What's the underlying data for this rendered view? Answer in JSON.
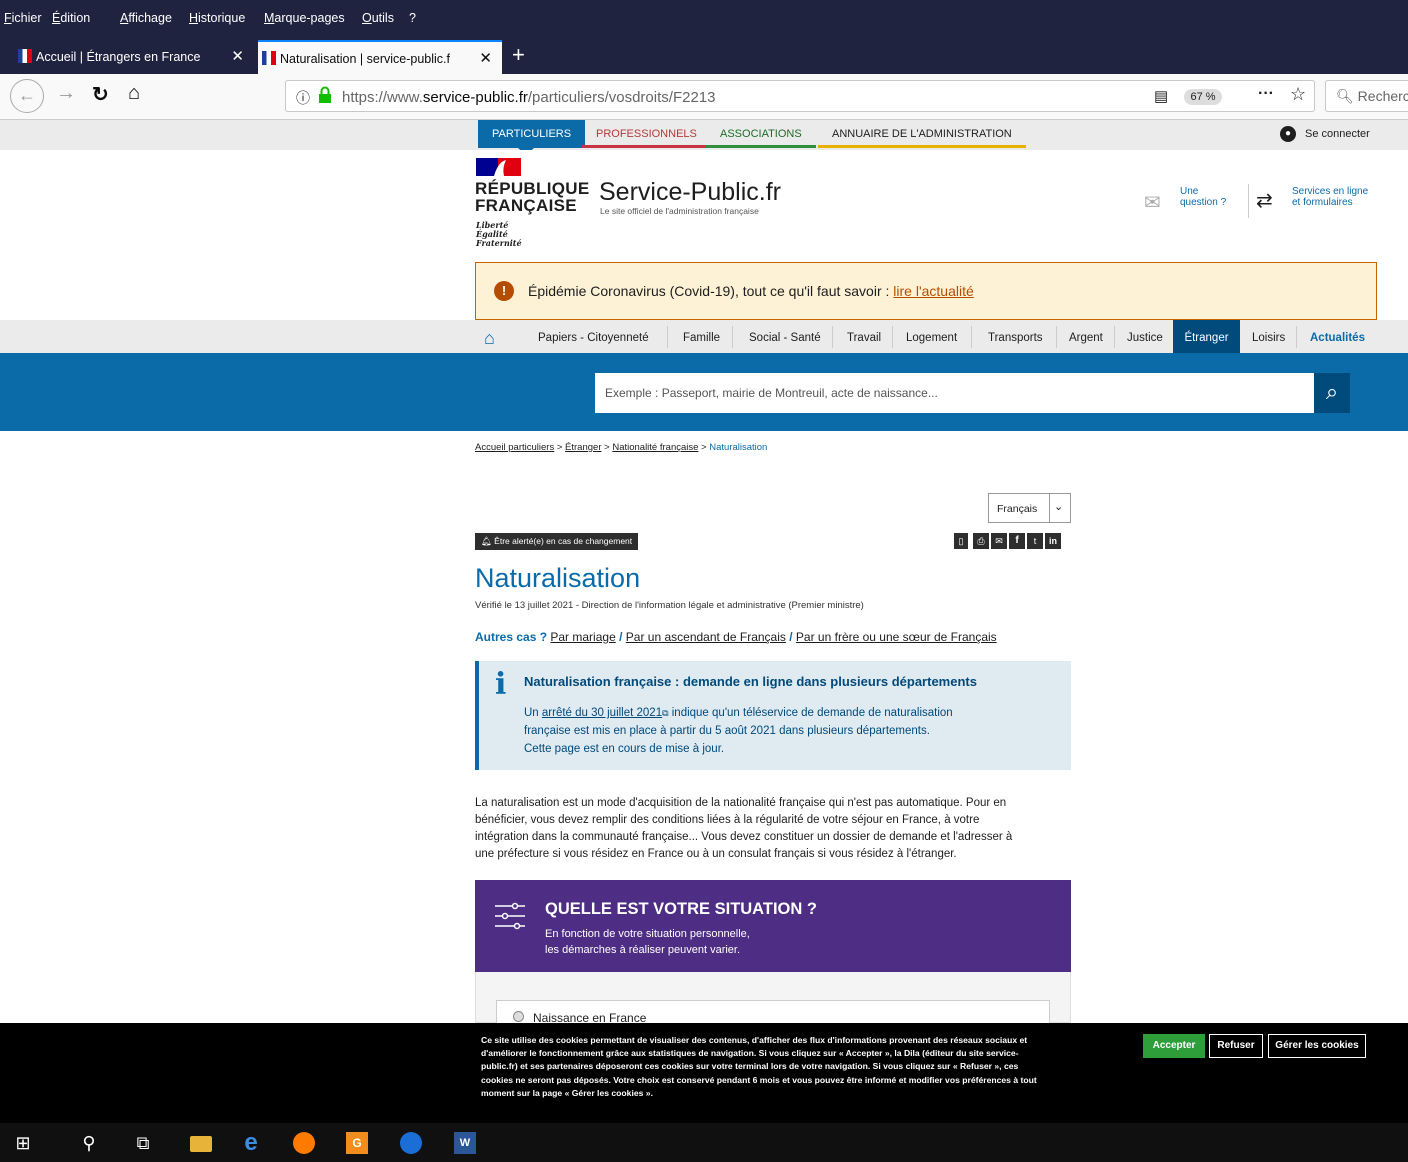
{
  "menubar": {
    "items": [
      "Fichier",
      "Édition",
      "Affichage",
      "Historique",
      "Marque-pages",
      "Outils",
      "?"
    ]
  },
  "tabs": [
    {
      "label": "Accueil | Étrangers en France"
    },
    {
      "label": "Naturalisation | service-public.f"
    }
  ],
  "navbar": {
    "url_prefix": "https://www.",
    "url_domain": "service-public.fr",
    "url_path": "/particuliers/vosdroits/F2213",
    "zoom": "67 %",
    "search_placeholder": "Recherc"
  },
  "topnav": {
    "items": [
      "PARTICULIERS",
      "PROFESSIONNELS",
      "ASSOCIATIONS",
      "ANNUAIRE DE L'ADMINISTRATION"
    ],
    "login": "Se connecter"
  },
  "header": {
    "rf_line1": "RÉPUBLIQUE",
    "rf_line2": "FRANÇAISE",
    "motto1": "Liberté",
    "motto2": "Égalité",
    "motto3": "Fraternité",
    "site_name": "Service-Public.fr",
    "site_tagline": "Le site officiel de l'administration française",
    "question_1": "Une",
    "question_2": "question ?",
    "services_1": "Services en ligne",
    "services_2": "et formulaires"
  },
  "covid": {
    "text": "Épidémie Coronavirus (Covid-19), tout ce qu'il faut savoir : ",
    "link": "lire l'actualité"
  },
  "catnav": {
    "items": [
      "Papiers - Citoyenneté",
      "Famille",
      "Social - Santé",
      "Travail",
      "Logement",
      "Transports",
      "Argent",
      "Justice",
      "Étranger",
      "Loisirs",
      "Actualités"
    ]
  },
  "search": {
    "placeholder": "Exemple : Passeport, mairie de Montreuil, acte de naissance..."
  },
  "breadcrumb": {
    "items": [
      "Accueil particuliers",
      "Étranger",
      "Nationalité française",
      "Naturalisation"
    ],
    "sep": ">"
  },
  "lang": {
    "selected": "Français"
  },
  "alert_btn": "Être alerté(e) en cas de changement",
  "page": {
    "title": "Naturalisation",
    "verified": "Vérifié le 13 juillet 2021 - Direction de l'information légale et administrative (Premier ministre)",
    "autres_label": "Autres cas ?",
    "autres_links": [
      "Par mariage",
      "Par un ascendant de Français",
      "Par un frère ou une sœur de Français"
    ],
    "info_title": "Naturalisation française : demande en ligne dans plusieurs départements",
    "info_pre": "Un ",
    "info_link": "arrêté du 30 juillet 2021",
    "info_text1": " indique qu'un téléservice de demande de naturalisation",
    "info_text2": "française est mis en place à partir du 5 août 2021 dans plusieurs départements.",
    "info_text3": "Cette page est en cours de mise à jour.",
    "intro1": "La naturalisation est un mode d'acquisition de la nationalité française qui n'est pas automatique. Pour en",
    "intro2": "bénéficier, vous devez remplir des conditions liées à la régularité de votre séjour en France, à votre",
    "intro3": "intégration dans la communauté française... Vous devez constituer un dossier de demande et l'adresser à",
    "intro4": "une préfecture si vous résidez en France ou à un consulat français si vous résidez à l'étranger.",
    "situation_title": "QUELLE EST VOTRE SITUATION ?",
    "situation_sub1": "En fonction de votre situation personnelle,",
    "situation_sub2": "les démarches à réaliser peuvent varier.",
    "radio1": "Naissance en France"
  },
  "cookie": {
    "l1": "Ce site utilise des cookies permettant de visualiser des contenus, d'afficher des flux d'informations provenant des réseaux sociaux et",
    "l2": "d'améliorer le fonctionnement grâce aux statistiques de navigation. Si vous cliquez sur « Accepter », la Dila (éditeur du site service-",
    "l3": "public.fr) et ses partenaires déposeront ces cookies sur votre terminal lors de votre navigation. Si vous cliquez sur « Refuser », ces",
    "l4": "cookies ne seront pas déposés. Votre choix est conservé pendant 6 mois et vous pouvez être informé et modifier vos préférences à tout",
    "l5": "moment sur la page « Gérer les cookies ».",
    "accept": "Accepter",
    "refuse": "Refuser",
    "manage": "Gérer les cookies"
  },
  "colors": {
    "blue": "#0b6ba8",
    "purple": "#4e2e84",
    "navy": "#000091",
    "red": "#e1000f"
  }
}
